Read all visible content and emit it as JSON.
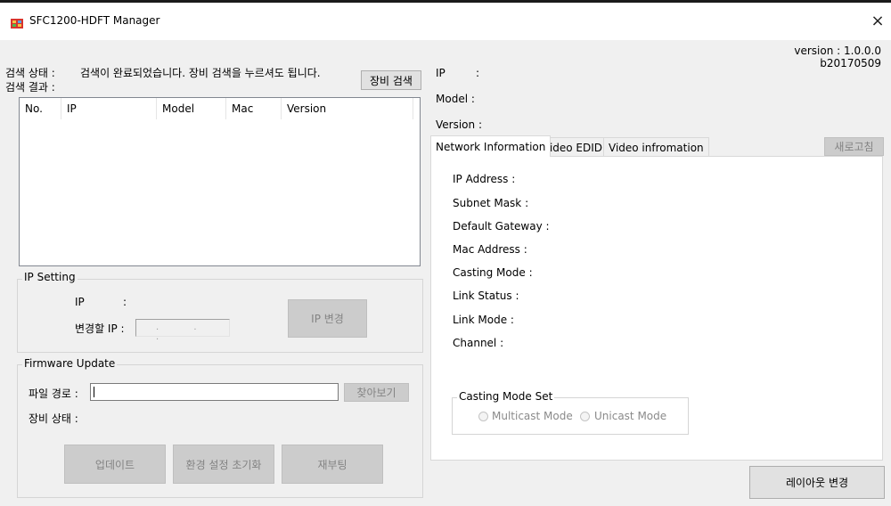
{
  "window": {
    "title": "SFC1200-HDFT Manager",
    "close_glyph": "×"
  },
  "search": {
    "status_label": "검색 상태 :",
    "status_text": "검색이 완료되었습니다. 장비 검색을 누르셔도 됩니다.",
    "result_label": "검색 결과 :",
    "button": "장비 검색",
    "columns": [
      "No.",
      "IP",
      "Model",
      "Mac",
      "Version"
    ]
  },
  "ip_setting": {
    "group_title": "IP Setting",
    "ip_label": "IP",
    "ip_colon": ":",
    "new_ip_label": "변경할 IP :",
    "ip_box_dots": ". . .",
    "button": "IP 변경"
  },
  "firmware": {
    "group_title": "Firmware Update",
    "path_label": "파일 경로 :",
    "path_value": "",
    "browse_button": "찾아보기",
    "device_status_label": "장비 상태 :",
    "update_button": "업데이트",
    "reset_button": "환경 설정 초기화",
    "reboot_button": "재부팅"
  },
  "device": {
    "version_line1": "version : 1.0.0.0",
    "version_line2": "b20170509",
    "ip_label": "IP",
    "ip_colon": ":",
    "model_label": "Model :",
    "version_label": "Version :"
  },
  "tabs": [
    "Network Information",
    "Video EDID",
    "Video infromation"
  ],
  "refresh_button": "새로고침",
  "network_info": [
    "IP Address :",
    "Subnet Mask :",
    "Default Gateway :",
    "Mac Address :",
    "Casting Mode :",
    "Link Status :",
    "Link Mode :",
    "Channel :"
  ],
  "casting_mode_set": {
    "title": "Casting Mode Set",
    "options": [
      "Multicast Mode",
      "Unicast Mode"
    ]
  },
  "layout_button": "레이아웃 변경"
}
